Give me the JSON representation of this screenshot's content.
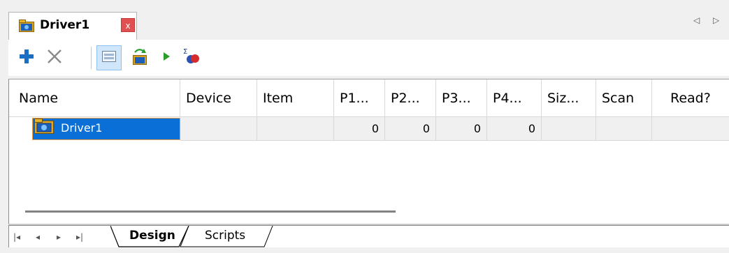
{
  "document_tab": {
    "title": "Driver1",
    "close_label": "x",
    "icon": "driver-folder-icon"
  },
  "tab_scroll": {
    "left_label": "◁",
    "right_label": "▷"
  },
  "toolbar": {
    "buttons": [
      {
        "name": "add-button",
        "icon": "plus-icon"
      },
      {
        "name": "delete-button",
        "icon": "x-icon"
      },
      {
        "name": "grid-view-button",
        "icon": "grid-view-icon",
        "active": true
      },
      {
        "name": "open-folder-button",
        "icon": "open-folder-icon"
      },
      {
        "name": "run-button",
        "icon": "play-icon"
      },
      {
        "name": "sum-button",
        "icon": "sigma-icon"
      }
    ]
  },
  "grid": {
    "columns": [
      "Name",
      "Device",
      "Item",
      "P1...",
      "P2...",
      "P3...",
      "P4...",
      "Siz...",
      "Scan",
      "Read?"
    ],
    "rows": [
      {
        "name": "Driver1",
        "device": "",
        "item": "",
        "p1": "0",
        "p2": "0",
        "p3": "0",
        "p4": "0",
        "size": "",
        "scan": "",
        "read": ""
      }
    ]
  },
  "sheet_tabs": {
    "nav": [
      "|◂",
      "◂",
      "▸",
      "▸|"
    ],
    "tabs": [
      {
        "label": "Design",
        "active": true
      },
      {
        "label": "Scripts",
        "active": false
      }
    ]
  },
  "colors": {
    "selection": "#0a6fd6",
    "selection_border": "#f0a044",
    "close": "#e05050",
    "add": "#1a6fc4",
    "run": "#2a9d2a"
  }
}
